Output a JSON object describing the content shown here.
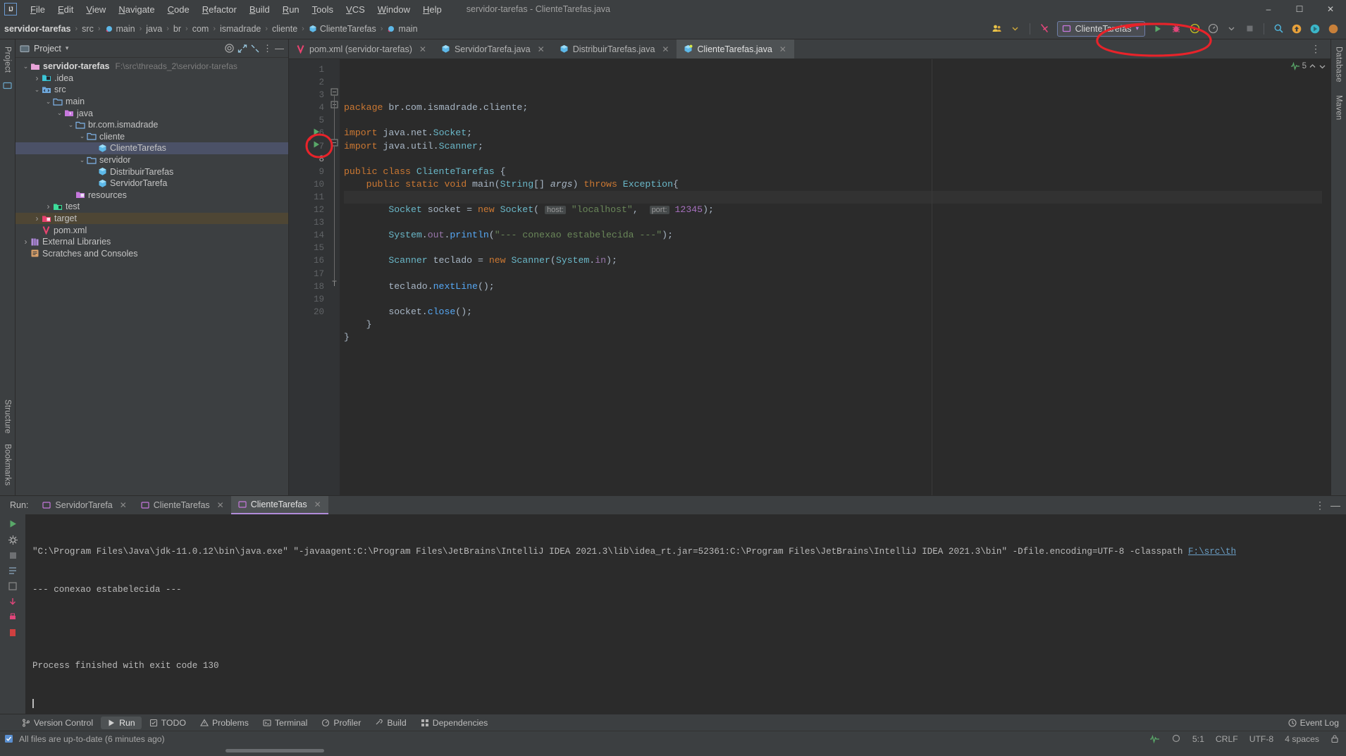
{
  "window": {
    "title": "servidor-tarefas - ClienteTarefas.java",
    "logo": "IJ"
  },
  "menu": {
    "items": [
      "File",
      "Edit",
      "View",
      "Navigate",
      "Code",
      "Refactor",
      "Build",
      "Run",
      "Tools",
      "VCS",
      "Window",
      "Help"
    ]
  },
  "window_controls": {
    "minimize": "–",
    "maximize": "☐",
    "close": "✕"
  },
  "breadcrumb": {
    "items": [
      "servidor-tarefas",
      "src",
      "main",
      "java",
      "br",
      "com",
      "ismadrade",
      "cliente",
      "ClienteTarefas",
      "main"
    ],
    "separator": "›"
  },
  "toolbar": {
    "run_config_label": "ClienteTarefas",
    "run_config_dropdown": "▾",
    "run_button": "run-button",
    "debug_button": "debug-button",
    "run_coverage_button": "run-with-coverage-button",
    "profiler_button": "profiler-button",
    "stop_button": "stop-button",
    "search_button": "search-everywhere-button",
    "update_button": "update-project-button",
    "settings_button": "settings-button",
    "account_button": "account-button"
  },
  "project_panel": {
    "title": "Project",
    "dropdown": "▾",
    "tree": [
      {
        "indent": 0,
        "twisty": "⌄",
        "icon": "folder-module",
        "icon_color": "#e8a3d8",
        "label": "servidor-tarefas",
        "bold": true,
        "path": "F:\\src\\threads_2\\servidor-tarefas",
        "state": "normal"
      },
      {
        "indent": 1,
        "twisty": "›",
        "icon": "folder-idea",
        "icon_color": "#4fc3d9",
        "label": ".idea",
        "bold": false,
        "path": "",
        "state": "normal"
      },
      {
        "indent": 1,
        "twisty": "⌄",
        "icon": "folder-src",
        "icon_color": "#7fb3e8",
        "label": "src",
        "bold": false,
        "path": "",
        "state": "normal"
      },
      {
        "indent": 2,
        "twisty": "⌄",
        "icon": "folder",
        "icon_color": "#7fb3e8",
        "label": "main",
        "bold": false,
        "path": "",
        "state": "normal"
      },
      {
        "indent": 3,
        "twisty": "⌄",
        "icon": "folder-java",
        "icon_color": "#c678dd",
        "label": "java",
        "bold": false,
        "path": "",
        "state": "normal"
      },
      {
        "indent": 4,
        "twisty": "⌄",
        "icon": "folder-package",
        "icon_color": "#7fb3e8",
        "label": "br.com.ismadrade",
        "bold": false,
        "path": "",
        "state": "normal"
      },
      {
        "indent": 5,
        "twisty": "⌄",
        "icon": "folder-package",
        "icon_color": "#7fb3e8",
        "label": "cliente",
        "bold": false,
        "path": "",
        "state": "normal"
      },
      {
        "indent": 6,
        "twisty": "",
        "icon": "java-class",
        "icon_color": "#5db8e8",
        "label": "ClienteTarefas",
        "bold": false,
        "path": "",
        "state": "selected"
      },
      {
        "indent": 5,
        "twisty": "⌄",
        "icon": "folder-package",
        "icon_color": "#7fb3e8",
        "label": "servidor",
        "bold": false,
        "path": "",
        "state": "normal"
      },
      {
        "indent": 6,
        "twisty": "",
        "icon": "java-class",
        "icon_color": "#5db8e8",
        "label": "DistribuirTarefas",
        "bold": false,
        "path": "",
        "state": "normal"
      },
      {
        "indent": 6,
        "twisty": "",
        "icon": "java-class",
        "icon_color": "#5db8e8",
        "label": "ServidorTarefa",
        "bold": false,
        "path": "",
        "state": "normal"
      },
      {
        "indent": 4,
        "twisty": "",
        "icon": "folder-resources",
        "icon_color": "#c678dd",
        "label": "resources",
        "bold": false,
        "path": "",
        "state": "normal"
      },
      {
        "indent": 2,
        "twisty": "›",
        "icon": "folder-test",
        "icon_color": "#3ddc9a",
        "label": "test",
        "bold": false,
        "path": "",
        "state": "normal"
      },
      {
        "indent": 1,
        "twisty": "›",
        "icon": "folder-target",
        "icon_color": "#e8436f",
        "label": "target",
        "bold": false,
        "path": "",
        "state": "highlight"
      },
      {
        "indent": 1,
        "twisty": "",
        "icon": "maven-file",
        "icon_color": "#e8436f",
        "label": "pom.xml",
        "bold": false,
        "path": "",
        "state": "normal"
      },
      {
        "indent": 0,
        "twisty": "›",
        "icon": "library",
        "icon_color": "#b18cd9",
        "label": "External Libraries",
        "bold": false,
        "path": "",
        "state": "normal"
      },
      {
        "indent": 0,
        "twisty": "",
        "icon": "scratches",
        "icon_color": "#d9a06a",
        "label": "Scratches and Consoles",
        "bold": false,
        "path": "",
        "state": "normal"
      }
    ]
  },
  "left_strip": {
    "project_label": "Project",
    "structure_label": "Structure",
    "bookmarks_label": "Bookmarks"
  },
  "right_strip": {
    "database_label": "Database",
    "maven_label": "Maven"
  },
  "editor_tabs": [
    {
      "label": "pom.xml (servidor-tarefas)",
      "icon": "maven-file",
      "icon_color": "#e8436f",
      "active": false,
      "close": "✕"
    },
    {
      "label": "ServidorTarefa.java",
      "icon": "java-class",
      "icon_color": "#5db8e8",
      "active": false,
      "close": "✕"
    },
    {
      "label": "DistribuirTarefas.java",
      "icon": "java-class",
      "icon_color": "#5db8e8",
      "active": false,
      "close": "✕"
    },
    {
      "label": "ClienteTarefas.java",
      "icon": "java-class-main",
      "icon_color": "#5db8e8",
      "active": true,
      "close": "✕"
    }
  ],
  "editor": {
    "inspection_count": "5",
    "line_numbers": [
      "1",
      "2",
      "3",
      "4",
      "5",
      "6",
      "7",
      "8",
      "9",
      "10",
      "11",
      "12",
      "13",
      "14",
      "15",
      "16",
      "17",
      "18",
      "19",
      "20"
    ],
    "current_line": 8,
    "code_lines": [
      {
        "n": 1,
        "text": "package br.com.ismadrade.cliente;"
      },
      {
        "n": 2,
        "text": ""
      },
      {
        "n": 3,
        "text": "import java.net.Socket;"
      },
      {
        "n": 4,
        "text": "import java.util.Scanner;"
      },
      {
        "n": 5,
        "text": ""
      },
      {
        "n": 6,
        "text": "public class ClienteTarefas {"
      },
      {
        "n": 7,
        "text": "    public static void main(String[] args) throws Exception{"
      },
      {
        "n": 8,
        "text": ""
      },
      {
        "n": 9,
        "text": "        Socket socket = new Socket( host: \"localhost\",  port: 12345);"
      },
      {
        "n": 10,
        "text": ""
      },
      {
        "n": 11,
        "text": "        System.out.println(\"--- conexao estabelecida ---\");"
      },
      {
        "n": 12,
        "text": ""
      },
      {
        "n": 13,
        "text": "        Scanner teclado = new Scanner(System.in);"
      },
      {
        "n": 14,
        "text": ""
      },
      {
        "n": 15,
        "text": "        teclado.nextLine();"
      },
      {
        "n": 16,
        "text": ""
      },
      {
        "n": 17,
        "text": "        socket.close();"
      },
      {
        "n": 18,
        "text": "    }"
      },
      {
        "n": 19,
        "text": "}"
      },
      {
        "n": 20,
        "text": ""
      }
    ],
    "param_hints": {
      "host": "host:",
      "port": "port:"
    }
  },
  "run_panel": {
    "label": "Run:",
    "tabs": [
      {
        "label": "ServidorTarefa",
        "active": false,
        "close": "✕"
      },
      {
        "label": "ClienteTarefas",
        "active": false,
        "close": "✕"
      },
      {
        "label": "ClienteTarefas",
        "active": true,
        "close": "✕"
      }
    ],
    "console": {
      "command_prefix": "\"C:\\Program Files\\Java\\jdk-11.0.12\\bin\\java.exe\" \"-javaagent:C:\\Program Files\\JetBrains\\IntelliJ IDEA 2021.3\\lib\\idea_rt.jar=52361:C:\\Program Files\\JetBrains\\IntelliJ IDEA 2021.3\\bin\" -Dfile.encoding=UTF-8 -classpath ",
      "command_path": "F:\\src\\th",
      "output_line": "--- conexao estabelecida ---",
      "exit_line": "Process finished with exit code 130"
    }
  },
  "tool_windows": {
    "items": [
      {
        "label": "Version Control",
        "icon": "branch-icon",
        "active": false
      },
      {
        "label": "Run",
        "icon": "run-icon",
        "active": true
      },
      {
        "label": "TODO",
        "icon": "todo-icon",
        "active": false
      },
      {
        "label": "Problems",
        "icon": "problems-icon",
        "active": false
      },
      {
        "label": "Terminal",
        "icon": "terminal-icon",
        "active": false
      },
      {
        "label": "Profiler",
        "icon": "profiler-icon",
        "active": false
      },
      {
        "label": "Build",
        "icon": "build-icon",
        "active": false
      },
      {
        "label": "Dependencies",
        "icon": "dependencies-icon",
        "active": false
      }
    ],
    "event_log": "Event Log"
  },
  "status_bar": {
    "message": "All files are up-to-date (6 minutes ago)",
    "caret_position": "5:1",
    "line_separator": "CRLF",
    "encoding": "UTF-8",
    "indent": "4 spaces"
  },
  "annotations": {
    "circle_runconfig": "red-circle-around-run-configuration",
    "circle_gutter_run": "red-circle-around-gutter-run-icon"
  },
  "colors": {
    "accent_red_annotation": "#e8232a",
    "selection_blue": "#4b5167",
    "editor_bg": "#2b2b2b",
    "panel_bg": "#3c3f41",
    "keyword_orange": "#cc7832",
    "string_green": "#6a8759",
    "number_purple": "#a771bf",
    "class_cyan": "#6ab8c9",
    "method_blue": "#56a8f5",
    "field_purple": "#9876aa",
    "plain_text": "#a9b7c6"
  }
}
